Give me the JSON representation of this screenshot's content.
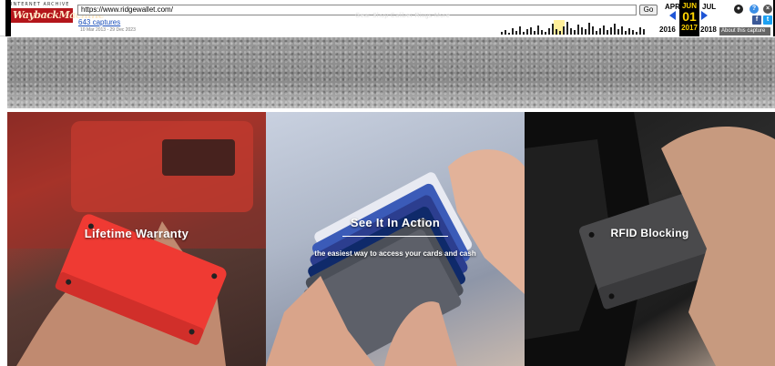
{
  "wayback": {
    "archive_label": "INTERNET ARCHIVE",
    "logo_text": "WaybackMachine",
    "url": "https://www.ridgewallet.com/",
    "go_label": "Go",
    "captures_link": "643 captures",
    "date_range": "10 Mar 2013 - 29 Dec 2023",
    "ghost_nav": "Gear   Shop   Caliber   Rings   More",
    "prev_month": "APR",
    "current_month": "JUN",
    "next_month": "JUL",
    "current_day": "01",
    "prev_year": "2016",
    "current_year": "2017",
    "next_year": "2018",
    "about_label": "About this capture",
    "icons": [
      "user-icon",
      "help-icon",
      "close-icon",
      "facebook-icon",
      "twitter-icon"
    ]
  },
  "panels": [
    {
      "title": "Lifetime Warranty",
      "subtitle": ""
    },
    {
      "title": "See It In Action",
      "subtitle": "the easiest way to access your cards and cash"
    },
    {
      "title": "RFID Blocking",
      "subtitle": ""
    }
  ],
  "colors": {
    "wayback_red": "#b4161b",
    "calendar_highlight": "#ffd400",
    "nav_arrow": "#1f55d6"
  }
}
